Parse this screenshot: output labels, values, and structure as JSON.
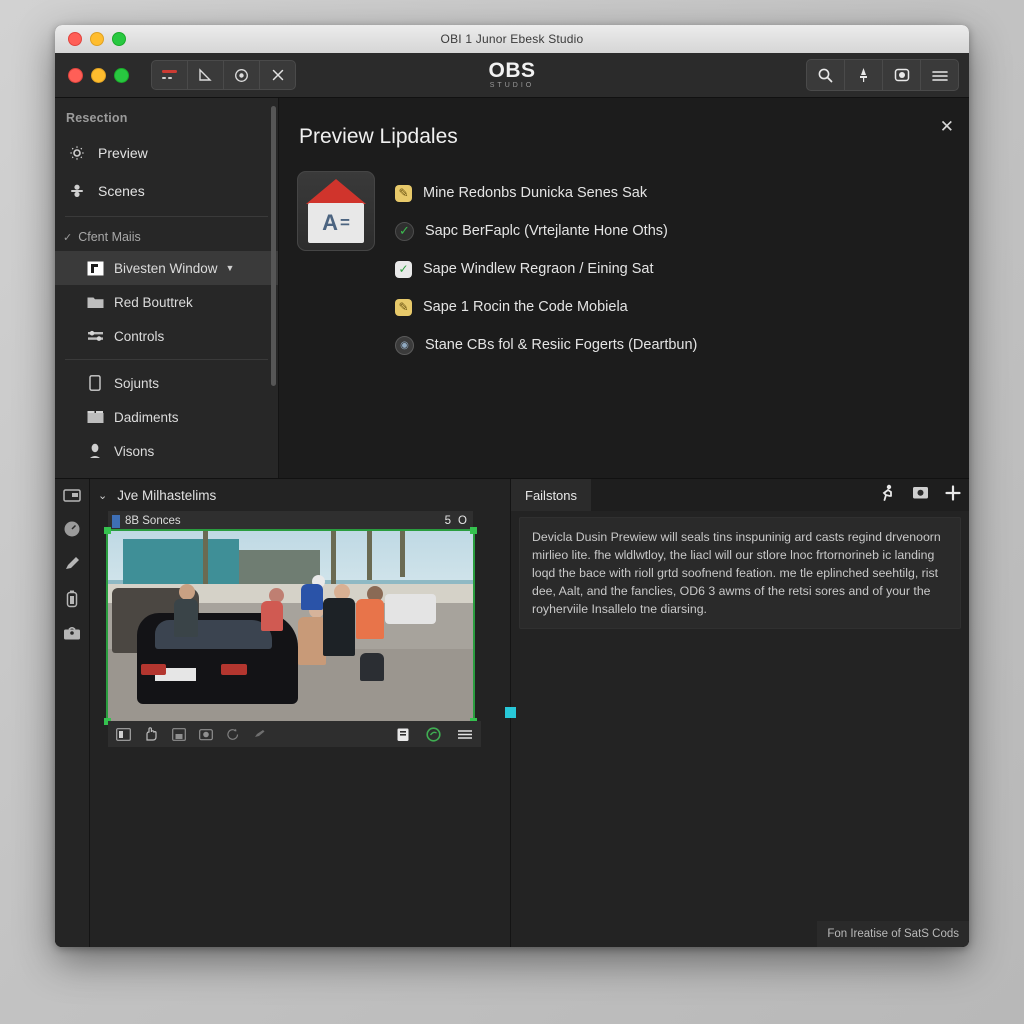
{
  "os_window": {
    "title": "OBI 1 Junor Ebesk Studio",
    "traffic": [
      "close",
      "minimize",
      "zoom"
    ]
  },
  "app": {
    "logo": {
      "name": "OBS",
      "subtitle": "STUDIO"
    },
    "toolbar_left_buttons": [
      {
        "name": "record-button",
        "glyph": "▬"
      },
      {
        "name": "triangle-tool-button",
        "glyph": "◣"
      },
      {
        "name": "clock-button",
        "glyph": "◎"
      },
      {
        "name": "close-button",
        "glyph": "✕"
      }
    ],
    "toolbar_right_buttons": [
      {
        "name": "search-icon",
        "glyph": "⌕"
      },
      {
        "name": "pin-icon",
        "glyph": "♟"
      },
      {
        "name": "camera-icon",
        "glyph": "◙"
      },
      {
        "name": "menu-icon",
        "glyph": "☰"
      }
    ]
  },
  "sidebar": {
    "section_label": "Resection",
    "items": [
      {
        "label": "Preview",
        "icon": "gear-icon",
        "glyph": "⚙"
      },
      {
        "label": "Scenes",
        "icon": "scenes-icon",
        "glyph": "✇"
      }
    ],
    "group_label": "Cfent Maiis",
    "sub_items": [
      {
        "label": "Bivesten Window",
        "icon": "window-icon",
        "glyph": "▣",
        "active": true,
        "caret": "▼"
      },
      {
        "label": "Red Bouttrek",
        "icon": "folder-icon",
        "glyph": "▰",
        "active": false
      },
      {
        "label": "Controls",
        "icon": "sliders-icon",
        "glyph": "⇶",
        "active": false
      }
    ],
    "bottom_items": [
      {
        "label": "Sojunts",
        "icon": "phone-icon",
        "glyph": "▯"
      },
      {
        "label": "Dadiments",
        "icon": "archive-icon",
        "glyph": "▤"
      },
      {
        "label": "Visons",
        "icon": "person-icon",
        "glyph": "♟"
      }
    ]
  },
  "content": {
    "title": "Preview Lipdales",
    "close_glyph": "✕",
    "doc_icon": {
      "letter": "A",
      "equals": "="
    },
    "items": [
      {
        "label": "Mine Redonbs Dunicka Senes Sak",
        "state": "pencil",
        "glyph": "✎"
      },
      {
        "label": "Sapc BerFaplc (Vrtejlante Hone Oths)",
        "state": "greendark",
        "glyph": "✓"
      },
      {
        "label": "Sape Windlew Regraon / Eining Sat",
        "state": "greenlight",
        "glyph": "✓"
      },
      {
        "label": "Sape 1 Rocin the Code Mobiela",
        "state": "pencil",
        "glyph": "✎"
      },
      {
        "label": "Stane CBs fol & Resiic Fogerts (Deartbun)",
        "state": "circle",
        "glyph": "◉"
      }
    ]
  },
  "icon_rail": [
    {
      "name": "archive-icon",
      "glyph": "🗃"
    },
    {
      "name": "gauge-icon",
      "glyph": "◔"
    },
    {
      "name": "pen-icon",
      "glyph": "✎"
    },
    {
      "name": "battery-icon",
      "glyph": "▮"
    },
    {
      "name": "toolbox-icon",
      "glyph": "🧰"
    }
  ],
  "left_pane": {
    "header": "Jve Milhastelims",
    "chevron": "⌄",
    "source": {
      "label": "8B Sonces",
      "badge_number": "5",
      "badge_circle": "O",
      "clock_glyph": "◷"
    },
    "preview_toolbar": {
      "left_icons": [
        {
          "name": "frame-icon",
          "glyph": "▣"
        },
        {
          "name": "hand-icon",
          "glyph": "✋"
        },
        {
          "name": "save-icon",
          "glyph": "▤"
        },
        {
          "name": "image-icon",
          "glyph": "▨"
        },
        {
          "name": "refresh-icon",
          "glyph": "↻"
        },
        {
          "name": "brush-icon",
          "glyph": "✒"
        }
      ],
      "right_icons": [
        {
          "name": "clipboard-icon",
          "glyph": "▤"
        },
        {
          "name": "shield-icon",
          "glyph": "⬡"
        },
        {
          "name": "list-icon",
          "glyph": "☰"
        }
      ]
    }
  },
  "right_pane": {
    "tab_label": "Failstons",
    "tab_icons": [
      {
        "name": "runner-icon",
        "glyph": "🏃"
      },
      {
        "name": "camera-icon",
        "glyph": "▣"
      },
      {
        "name": "add-icon",
        "glyph": "✚"
      }
    ],
    "description": "Devicla Dusin Prewiew will seals tins inspuninig ard casts regind drvenoorn mirlieo lite. fhe wldlwtloy, the liacl will our stlore lnoc frtornorineb ic landing loqd the bace with rioll grtd soofnend feation. me tle eplinched seehtilg, rist dee, Aalt, and the fanclies, OD6 3 awms of the retsi sores and of your the royherviile Insallelo tne diarsing."
  },
  "status_bar": {
    "text": "Fon Ireatise of SatS Cods"
  },
  "colors": {
    "accent_green": "#2a9d3f",
    "handle_teal": "#28c8d8",
    "app_bg": "#1e1e1e",
    "sidebar_bg": "#272727"
  }
}
